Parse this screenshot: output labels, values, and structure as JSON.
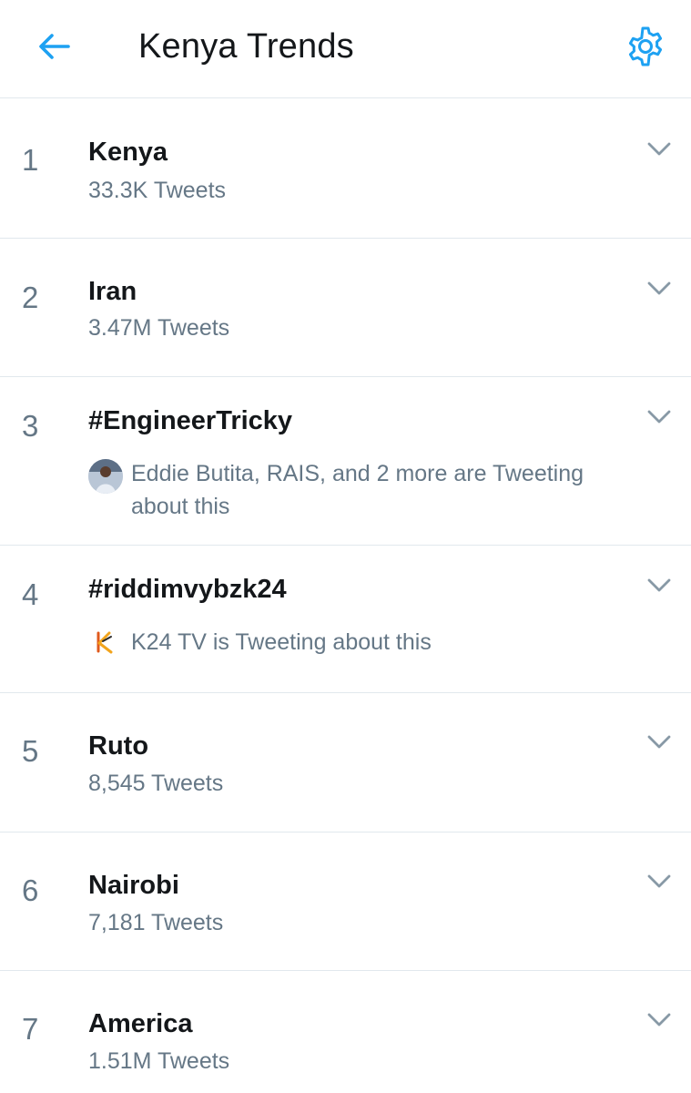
{
  "header": {
    "title": "Kenya Trends",
    "back_icon": "arrow-left-icon",
    "settings_icon": "gear-icon",
    "accent_color": "#1da1f2"
  },
  "trends": [
    {
      "rank": "1",
      "name": "Kenya",
      "count": "33.3K Tweets"
    },
    {
      "rank": "2",
      "name": "Iran",
      "count": "3.47M Tweets"
    },
    {
      "rank": "3",
      "name": "#EngineerTricky",
      "context": "Eddie Butita, RAIS, and 2 more are Tweeting about this"
    },
    {
      "rank": "4",
      "name": "#riddimvybzk24",
      "context": "K24 TV is Tweeting about this"
    },
    {
      "rank": "5",
      "name": "Ruto",
      "count": "8,545 Tweets"
    },
    {
      "rank": "6",
      "name": "Nairobi",
      "count": "7,181 Tweets"
    },
    {
      "rank": "7",
      "name": "America",
      "count": "1.51M Tweets"
    }
  ]
}
